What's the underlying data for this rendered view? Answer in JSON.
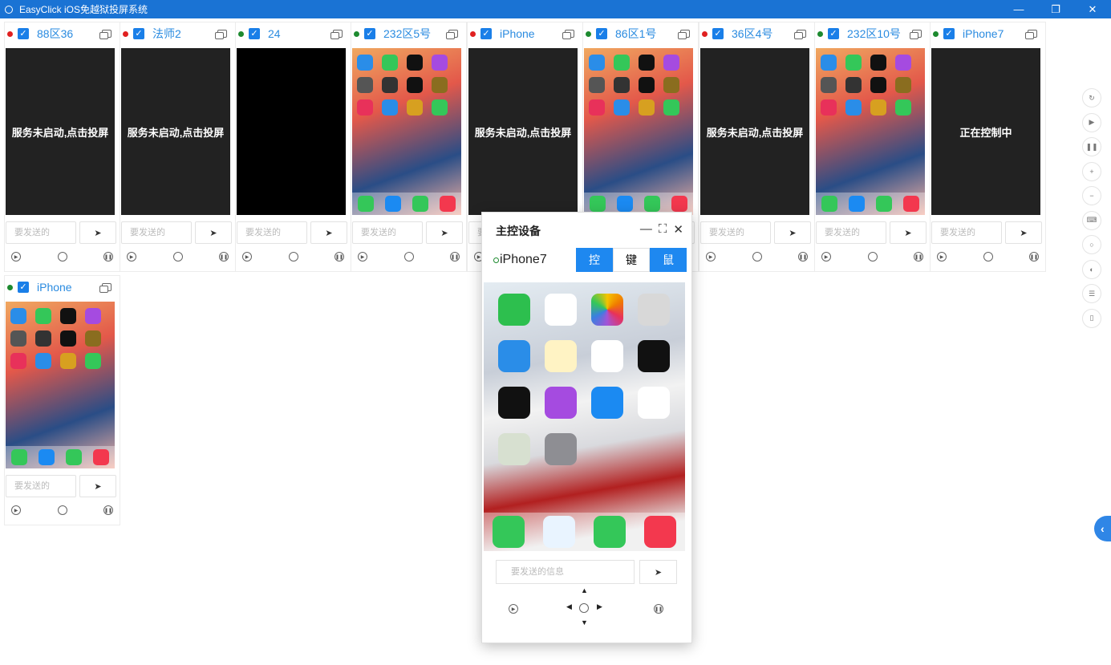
{
  "window": {
    "title": "EasyClick iOS免越狱投屏系统",
    "min": "—",
    "restore": "❐",
    "close": "✕"
  },
  "devices": [
    {
      "name": "88区36",
      "status": "red",
      "screen_text": "服务未启动,点击投屏",
      "screen": "dark"
    },
    {
      "name": "法师2",
      "status": "red",
      "screen_text": "服务未启动,点击投屏",
      "screen": "dark"
    },
    {
      "name": "24",
      "status": "green",
      "screen_text": "",
      "screen": "black"
    },
    {
      "name": "232区5号",
      "status": "green",
      "screen_text": "",
      "screen": "home"
    },
    {
      "name": "iPhone",
      "status": "red",
      "screen_text": "服务未启动,点击投屏",
      "screen": "dark"
    },
    {
      "name": "86区1号",
      "status": "green",
      "screen_text": "",
      "screen": "home"
    },
    {
      "name": "36区4号",
      "status": "red",
      "screen_text": "服务未启动,点击投屏",
      "screen": "dark"
    },
    {
      "name": "232区10号",
      "status": "green",
      "screen_text": "",
      "screen": "home"
    },
    {
      "name": "iPhone7",
      "status": "green",
      "screen_text": "正在控制中",
      "screen": "dark"
    },
    {
      "name": "iPhone",
      "status": "green",
      "screen_text": "",
      "screen": "home"
    }
  ],
  "card": {
    "msg_placeholder": "要发送的",
    "send_icon": "send-icon",
    "check": "✓"
  },
  "master": {
    "title": "主控设备",
    "device": "iPhone7",
    "tabs": [
      "控",
      "键",
      "鼠"
    ],
    "msg_placeholder": "要发送的信息",
    "min": "—",
    "full": "⛶",
    "close": "✕"
  },
  "colors": {
    "accent": "#1e88f0",
    "red_dot": "#e02020",
    "green_dot": "#1d8a2f",
    "titlebar": "#1a73d4"
  },
  "side_tools": [
    "refresh-icon",
    "play-icon",
    "pause-icon",
    "zoom-in-icon",
    "zoom-out-icon",
    "keyboard-icon",
    "search-icon",
    "toggle-icon",
    "sliders-icon",
    "phone-icon"
  ],
  "collapse": "‹"
}
